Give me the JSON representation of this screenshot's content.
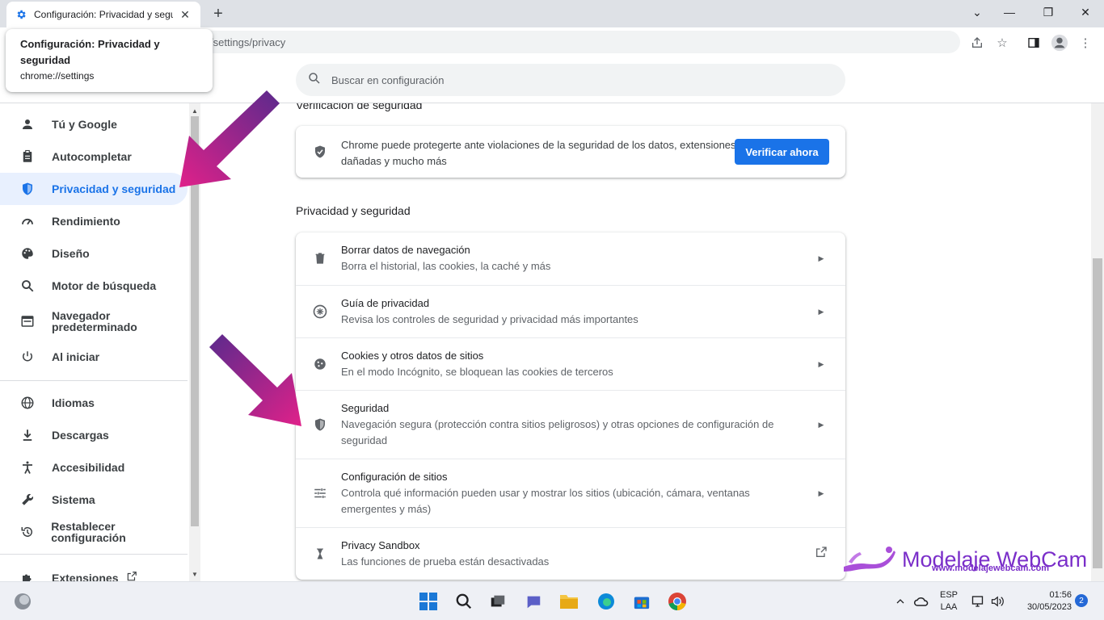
{
  "browser": {
    "tab_title": "Configuración: Privacidad y segu",
    "address_text": "/settings/privacy",
    "hovercard": {
      "title": "Configuración: Privacidad y seguridad",
      "url": "chrome://settings"
    }
  },
  "search": {
    "placeholder": "Buscar en configuración"
  },
  "sidebar": {
    "items": [
      {
        "label": "Tú y Google",
        "icon": "person-icon"
      },
      {
        "label": "Autocompletar",
        "icon": "clipboard-icon"
      },
      {
        "label": "Privacidad y seguridad",
        "icon": "shield-icon",
        "active": true
      },
      {
        "label": "Rendimiento",
        "icon": "speedometer-icon"
      },
      {
        "label": "Diseño",
        "icon": "palette-icon"
      },
      {
        "label": "Motor de búsqueda",
        "icon": "search-icon"
      },
      {
        "label": "Navegador predeterminado",
        "icon": "browser-window-icon"
      },
      {
        "label": "Al iniciar",
        "icon": "power-icon"
      },
      {
        "label": "Idiomas",
        "icon": "globe-icon"
      },
      {
        "label": "Descargas",
        "icon": "download-icon"
      },
      {
        "label": "Accesibilidad",
        "icon": "accessibility-icon"
      },
      {
        "label": "Sistema",
        "icon": "wrench-icon"
      },
      {
        "label": "Restablecer configuración",
        "icon": "restore-icon"
      },
      {
        "label": "Extensiones",
        "icon": "puzzle-icon"
      }
    ]
  },
  "main": {
    "safety_check": {
      "title": "Verificación de seguridad",
      "text": "Chrome puede protegerte ante violaciones de la seguridad de los datos, extensiones dañadas y mucho más",
      "button": "Verificar ahora"
    },
    "privacy_section": {
      "title": "Privacidad y seguridad",
      "rows": [
        {
          "title": "Borrar datos de navegación",
          "subtitle": "Borra el historial, las cookies, la caché y más",
          "icon": "trash-icon"
        },
        {
          "title": "Guía de privacidad",
          "subtitle": "Revisa los controles de seguridad y privacidad más importantes",
          "icon": "privacy-guide-icon"
        },
        {
          "title": "Cookies y otros datos de sitios",
          "subtitle": "En el modo Incógnito, se bloquean las cookies de terceros",
          "icon": "cookie-icon"
        },
        {
          "title": "Seguridad",
          "subtitle": "Navegación segura (protección contra sitios peligrosos) y otras opciones de configuración de seguridad",
          "icon": "security-shield-icon"
        },
        {
          "title": "Configuración de sitios",
          "subtitle": "Controla qué información pueden usar y mostrar los sitios (ubicación, cámara, ventanas emergentes y más)",
          "icon": "sliders-icon"
        },
        {
          "title": "Privacy Sandbox",
          "subtitle": "Las funciones de prueba están desactivadas",
          "icon": "flask-icon"
        }
      ]
    }
  },
  "watermark": {
    "title": "Modelaje WebCam",
    "url": "www.modelajewebcam.com"
  },
  "taskbar": {
    "lang_top": "ESP",
    "lang_bottom": "LAA",
    "time": "01:56",
    "date": "30/05/2023",
    "notifications": "2"
  },
  "colors": {
    "accent": "#1a73e8",
    "active_bg": "#e8f0fe",
    "arrow_start": "#5b2a8c",
    "arrow_end": "#e0218a",
    "watermark": "#7a2ec9"
  }
}
